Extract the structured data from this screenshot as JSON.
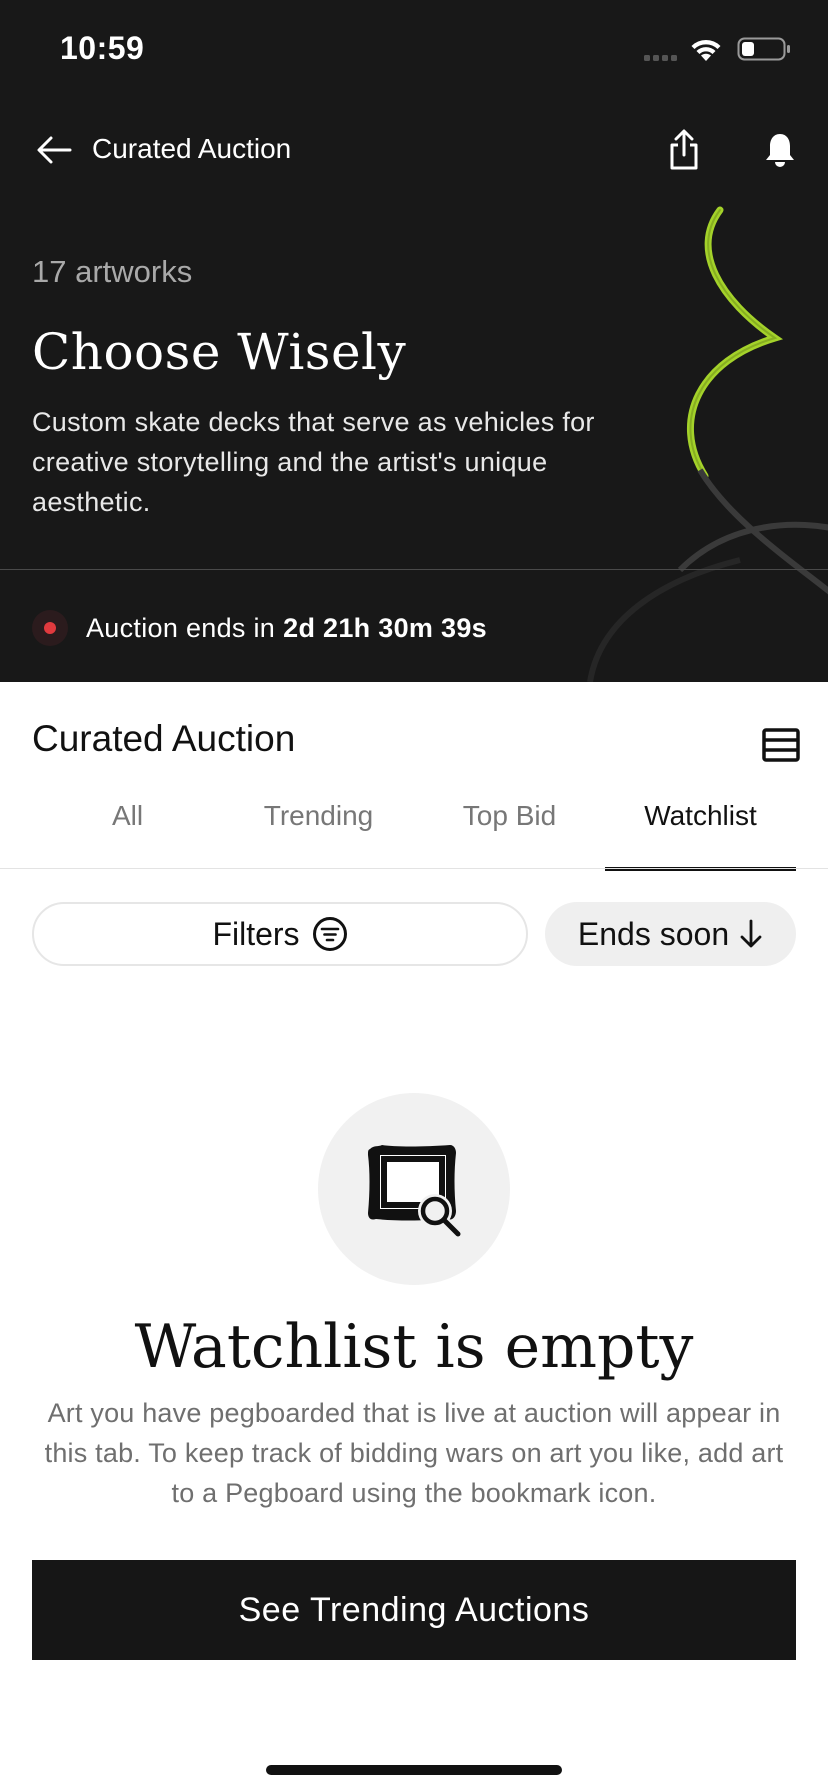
{
  "status_bar": {
    "time": "10:59",
    "icons": [
      "signal-icon",
      "wifi-icon",
      "battery-icon"
    ]
  },
  "nav": {
    "title": "Curated Auction",
    "back_icon": "arrow-left-icon",
    "share_icon": "share-icon",
    "bell_icon": "bell-icon"
  },
  "hero": {
    "artwork_count": "17 artworks",
    "title": "Choose Wisely",
    "description": "Custom skate decks that serve as vehicles for creative storytelling and the artist's unique aesthetic.",
    "countdown_label": "Auction ends in",
    "countdown_time": "2d 21h 30m 39s",
    "accent_color": "#a4d22a",
    "live_dot_color": "#e03a3e"
  },
  "section": {
    "title": "Curated Auction",
    "view_toggle_icon": "list-view-icon"
  },
  "tabs": [
    {
      "label": "All",
      "active": false
    },
    {
      "label": "Trending",
      "active": false
    },
    {
      "label": "Top Bid",
      "active": false
    },
    {
      "label": "Watchlist",
      "active": true
    }
  ],
  "controls": {
    "filters_label": "Filters",
    "filters_icon": "filter-icon",
    "sort_label": "Ends soon",
    "sort_icon": "arrow-down-icon"
  },
  "empty_state": {
    "icon": "frame-search-icon",
    "title": "Watchlist is empty",
    "body": "Art you have pegboarded that is live at auction will appear in this tab. To keep track of bidding wars on art you like, add art to a Pegboard using the bookmark icon.",
    "cta_label": "See Trending Auctions"
  }
}
